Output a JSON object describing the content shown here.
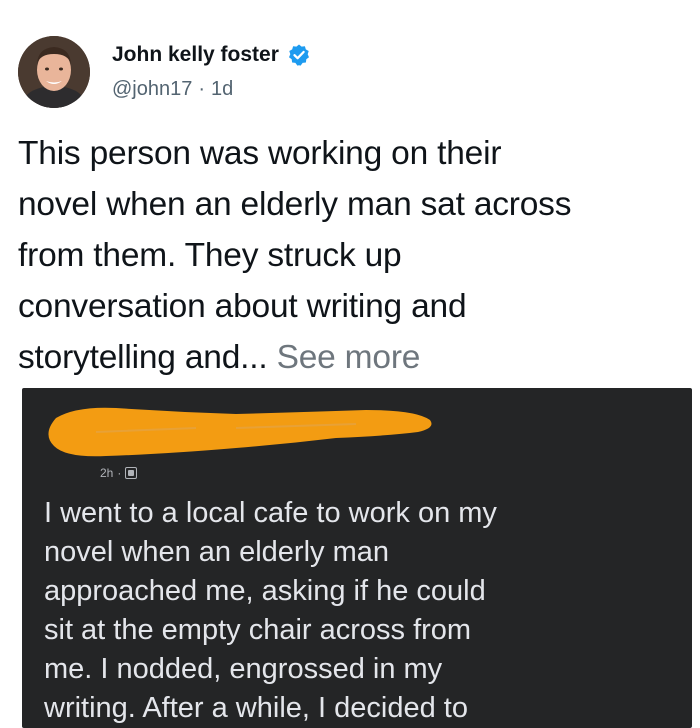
{
  "author": {
    "display_name": "John kelly foster",
    "handle": "@john17",
    "separator": "·",
    "time": "1d",
    "verified": true,
    "avatar_icon": "person-avatar"
  },
  "tweet": {
    "lines": [
      "This person was working on their",
      "novel when an elderly man sat across",
      "from them. They struck up",
      "conversation about writing and",
      "storytelling and..."
    ],
    "see_more": "See more"
  },
  "embedded_post": {
    "time": "2h",
    "separator": "·",
    "privacy_icon": "friends-icon",
    "redaction_color": "#f39c12",
    "lines": [
      "I went to a local cafe to work on my",
      "novel when an elderly man",
      "approached me, asking if he could",
      "sit at the empty chair across from",
      "me. I nodded, engrossed in my",
      "writing. After a while, I decided to"
    ]
  },
  "colors": {
    "verified_blue": "#1d9bf0",
    "card_bg": "#242526",
    "text_primary": "#0f1419",
    "text_secondary": "#536471"
  }
}
